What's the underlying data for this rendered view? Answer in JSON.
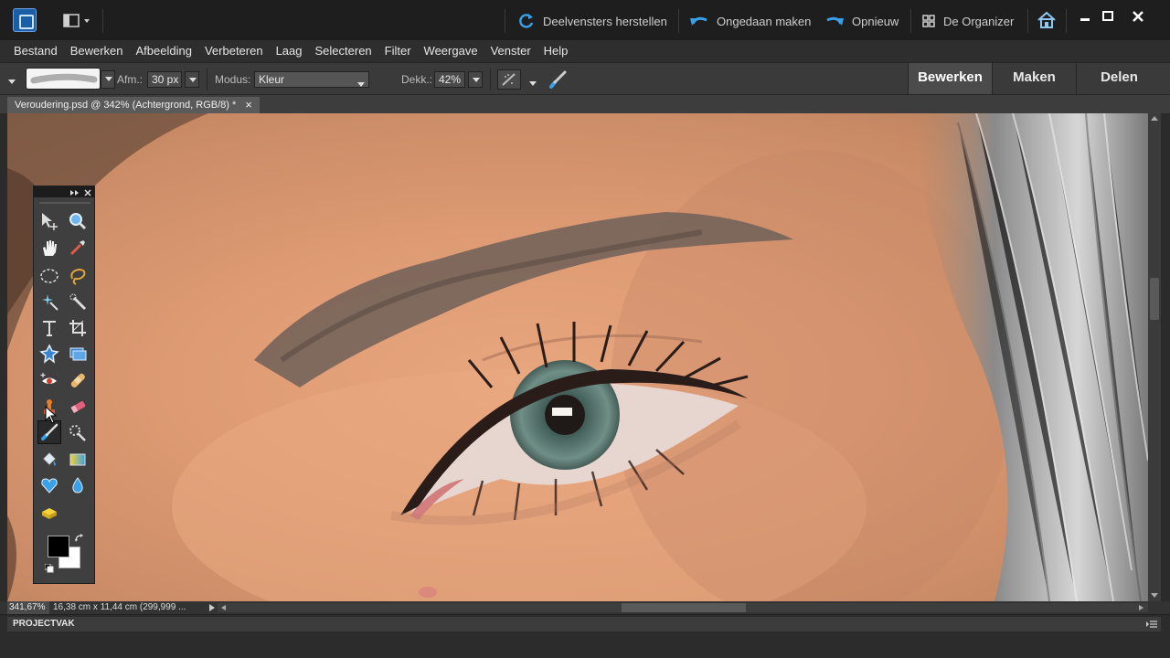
{
  "titlebar": {
    "restore_panels": "Deelvensters herstellen",
    "undo": "Ongedaan maken",
    "redo": "Opnieuw",
    "organizer": "De Organizer"
  },
  "menu": [
    "Bestand",
    "Bewerken",
    "Afbeelding",
    "Verbeteren",
    "Laag",
    "Selecteren",
    "Filter",
    "Weergave",
    "Venster",
    "Help"
  ],
  "options": {
    "size_label": "Afm.:",
    "size_value": "30 px",
    "mode_label": "Modus:",
    "mode_value": "Kleur",
    "opacity_label": "Dekk.:",
    "opacity_value": "42%"
  },
  "mode_tabs": [
    "Bewerken",
    "Maken",
    "Delen"
  ],
  "document": {
    "tab_title": "Veroudering.psd @ 342% (Achtergrond, RGB/8) *",
    "close": "×"
  },
  "status": {
    "zoom": "341,67%",
    "info": "16,38 cm x 11,44 cm (299,999 ..."
  },
  "project_bin": {
    "label": "PROJECTVAK"
  },
  "colors": {
    "foreground": "#000000",
    "background": "#ffffff",
    "accent_blue": "#3aa0e8"
  },
  "tools": [
    "move-tool",
    "zoom-tool",
    "hand-tool",
    "eyedropper-tool",
    "marquee-tool",
    "lasso-tool",
    "magic-wand-tool",
    "quick-selection-tool",
    "type-tool",
    "crop-tool",
    "cookie-cutter-tool",
    "straighten-tool",
    "red-eye-tool",
    "healing-brush-tool",
    "clone-stamp-tool",
    "eraser-tool",
    "brush-tool",
    "smart-brush-tool",
    "paint-bucket-tool",
    "gradient-tool",
    "custom-shape-tool",
    "blur-tool",
    "sponge-tool"
  ]
}
